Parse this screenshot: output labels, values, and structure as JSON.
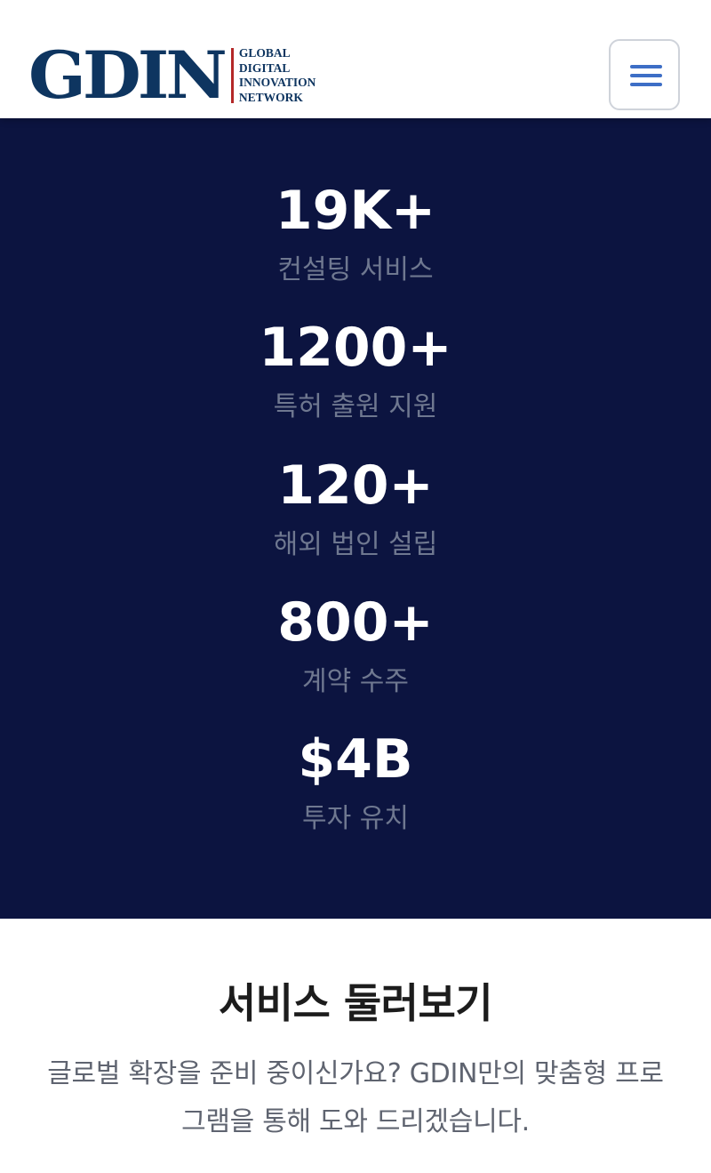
{
  "header": {
    "logo_mark": "GDIN",
    "logo_lines": [
      "GLOBAL",
      "DIGITAL",
      "INNOVATION",
      "NETWORK"
    ],
    "menu_icon": "hamburger-menu-icon"
  },
  "stats": [
    {
      "value": "19K+",
      "label": "컨설팅 서비스"
    },
    {
      "value": "1200+",
      "label": "특허 출원 지원"
    },
    {
      "value": "120+",
      "label": "해외 법인 설립"
    },
    {
      "value": "800+",
      "label": "계약 수주"
    },
    {
      "value": "$4B",
      "label": "투자 유치"
    }
  ],
  "services": {
    "title": "서비스 둘러보기",
    "description": "글로벌 확장을 준비 중이신가요? GDIN만의 맞춤형 프로그램을 통해 도와 드리겠습니다."
  },
  "colors": {
    "brand_navy": "#0e3560",
    "logo_accent_red": "#b42828",
    "stats_background": "#0c1440",
    "stat_label_gray": "#6f7890",
    "menu_icon_blue": "#3d6ec6"
  }
}
